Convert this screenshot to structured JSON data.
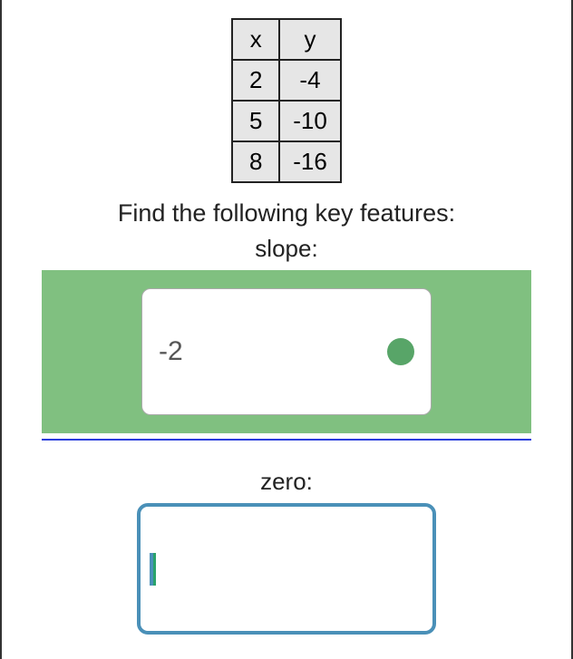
{
  "table": {
    "headers": {
      "x": "x",
      "y": "y"
    },
    "rows": [
      {
        "x": "2",
        "y": "-4"
      },
      {
        "x": "5",
        "y": "-10"
      },
      {
        "x": "8",
        "y": "-16"
      }
    ]
  },
  "prompt": "Find the following key features:",
  "fields": {
    "slope": {
      "label": "slope:",
      "value": "-2",
      "status": "correct"
    },
    "zero": {
      "label": "zero:",
      "value": "",
      "status": "active"
    }
  }
}
